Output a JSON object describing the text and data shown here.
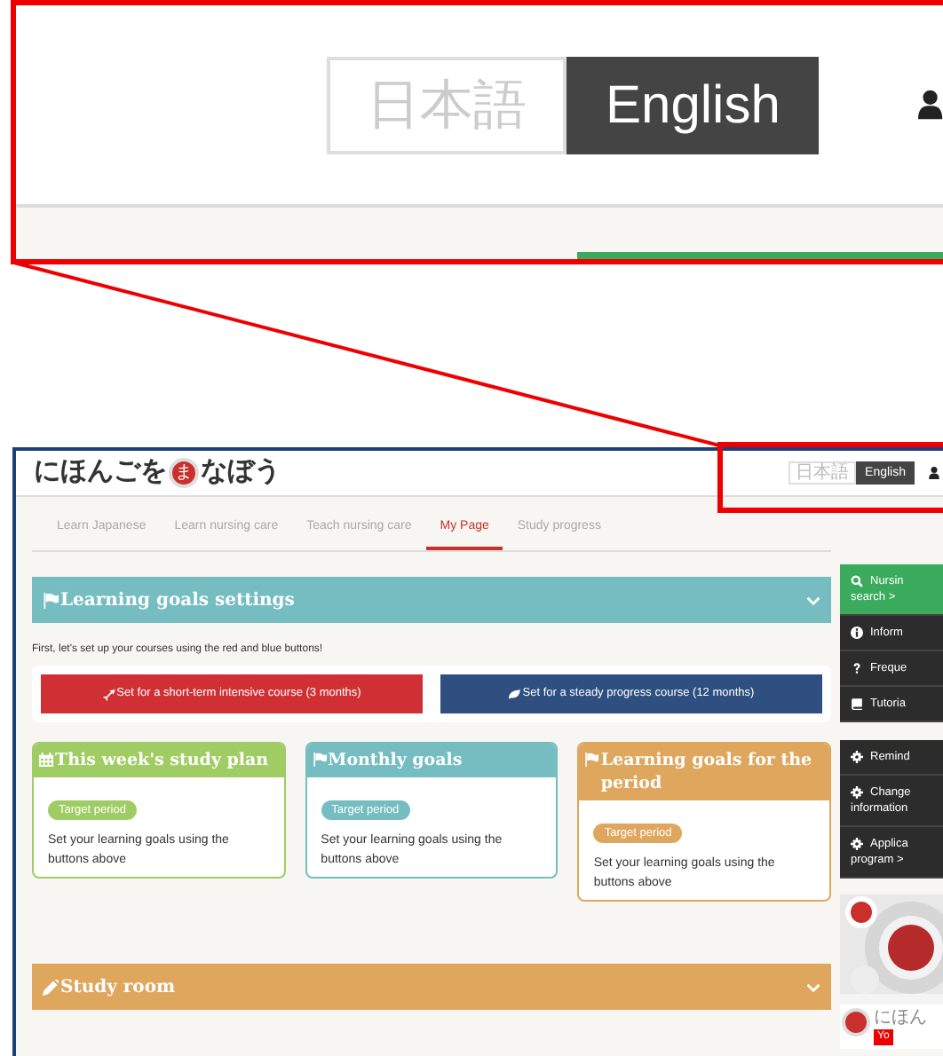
{
  "inset": {
    "languages": [
      {
        "label": "日本語",
        "selected": false
      },
      {
        "label": "English",
        "selected": true
      }
    ]
  },
  "header": {
    "logo_before": "にほんごを",
    "logo_mark": "ま",
    "logo_after": "なぼう",
    "languages": [
      {
        "label": "日本語",
        "selected": false
      },
      {
        "label": "English",
        "selected": true
      }
    ]
  },
  "tabs": [
    {
      "label": "Learn Japanese",
      "selected": false
    },
    {
      "label": "Learn nursing care",
      "selected": false
    },
    {
      "label": "Teach nursing care",
      "selected": false
    },
    {
      "label": "My Page",
      "selected": true
    },
    {
      "label": "Study progress",
      "selected": false
    }
  ],
  "goals_panel": {
    "title": "Learning goals settings",
    "intro": "First, let's set up your courses using the red and blue buttons!",
    "course_buttons": [
      {
        "label": "Set for a short-term intensive course (3 months)",
        "kind": "plane"
      },
      {
        "label": "Set for a steady progress course (12 months)",
        "kind": "leaf"
      }
    ],
    "goal_cards": [
      {
        "title": "This week's study plan",
        "kind": "calendar",
        "color": "#9fcd63",
        "badge": "Target period",
        "text": "Set your learning goals using the buttons above"
      },
      {
        "title": "Monthly goals",
        "kind": "flag",
        "color": "#76bdc1",
        "badge": "Target period",
        "text": "Set your learning goals using the buttons above"
      },
      {
        "title": "Learning goals for the period",
        "kind": "flag",
        "color": "#dfa75e",
        "badge": "Target period",
        "text": "Set your learning goals using the buttons above"
      }
    ]
  },
  "study_room": {
    "title": "Study room"
  },
  "sidebar": {
    "groups": [
      [
        {
          "kind": "search",
          "lines": [
            "Nursin",
            "search >"
          ],
          "highlight": true
        },
        {
          "kind": "info",
          "lines": [
            "Inform"
          ],
          "highlight": false
        },
        {
          "kind": "question",
          "lines": [
            "Freque"
          ],
          "highlight": false
        },
        {
          "kind": "book",
          "lines": [
            "Tutoria"
          ],
          "highlight": false
        }
      ],
      [
        {
          "kind": "gear",
          "lines": [
            "Remind"
          ],
          "highlight": false
        },
        {
          "kind": "gear",
          "lines": [
            "Change",
            "information"
          ],
          "highlight": false
        },
        {
          "kind": "gear",
          "lines": [
            "Applica",
            "program >"
          ],
          "highlight": false
        }
      ]
    ],
    "video": {
      "kind": "picture",
      "channel": "にほん",
      "button": "Yo"
    }
  }
}
